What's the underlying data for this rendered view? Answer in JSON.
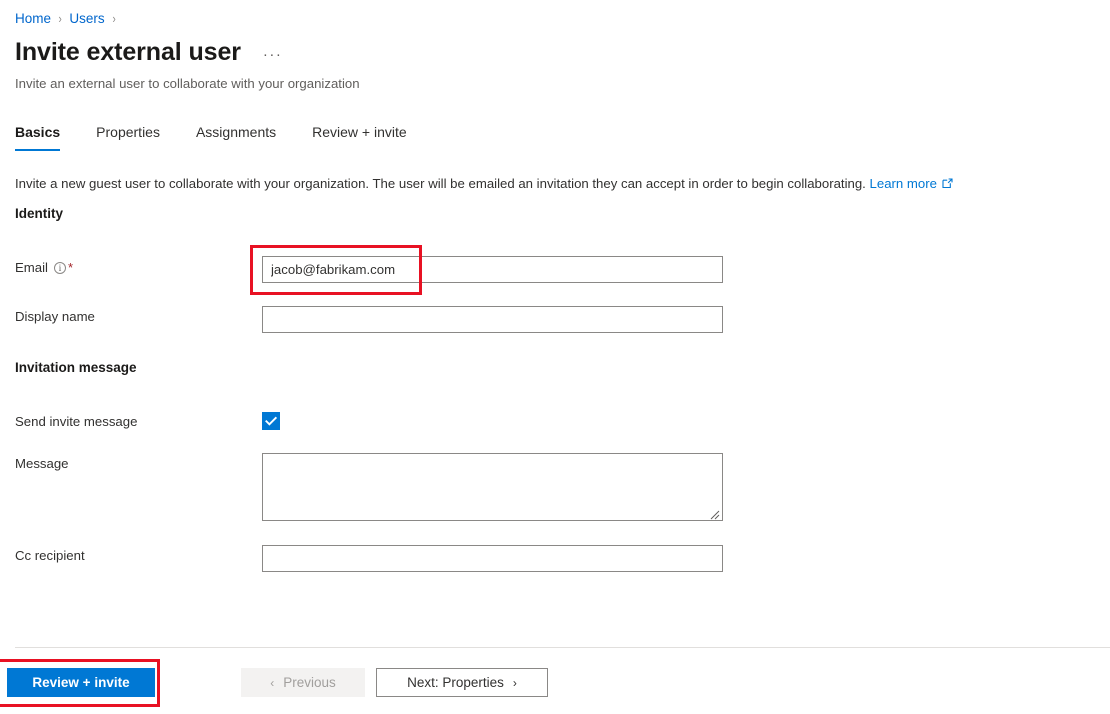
{
  "breadcrumb": {
    "items": [
      {
        "label": "Home",
        "separator": "›"
      },
      {
        "label": "Users",
        "separator": "›"
      }
    ]
  },
  "header": {
    "title": "Invite external user",
    "more_menu": "···",
    "subtitle": "Invite an external user to collaborate with your organization"
  },
  "tabs": [
    {
      "label": "Basics",
      "active": true
    },
    {
      "label": "Properties",
      "active": false
    },
    {
      "label": "Assignments",
      "active": false
    },
    {
      "label": "Review + invite",
      "active": false
    }
  ],
  "description": {
    "text": "Invite a new guest user to collaborate with your organization. The user will be emailed an invitation they can accept in order to begin collaborating.",
    "link_label": "Learn more",
    "link_icon": "external-link-icon"
  },
  "sections": {
    "identity": {
      "heading": "Identity",
      "email": {
        "label": "Email",
        "info_icon": "info-icon",
        "required_marker": "*",
        "value": "jacob@fabrikam.com",
        "placeholder": ""
      },
      "display_name": {
        "label": "Display name",
        "value": "",
        "placeholder": ""
      }
    },
    "invitation_message": {
      "heading": "Invitation message",
      "send_invite_message": {
        "label": "Send invite message",
        "checked": true,
        "check_glyph": "checkmark-icon"
      },
      "message": {
        "label": "Message",
        "value": "",
        "placeholder": ""
      },
      "cc_recipient": {
        "label": "Cc recipient",
        "value": "",
        "placeholder": ""
      }
    }
  },
  "footer": {
    "review_invite_label": "Review + invite",
    "previous_label": "Previous",
    "previous_chevron": "‹",
    "next_label": "Next: Properties",
    "next_chevron": "›"
  },
  "colors": {
    "accent": "#0078d4",
    "link": "#0066cc",
    "required": "#a4262c",
    "annotation": "#e81123",
    "border": "#8a8886"
  }
}
